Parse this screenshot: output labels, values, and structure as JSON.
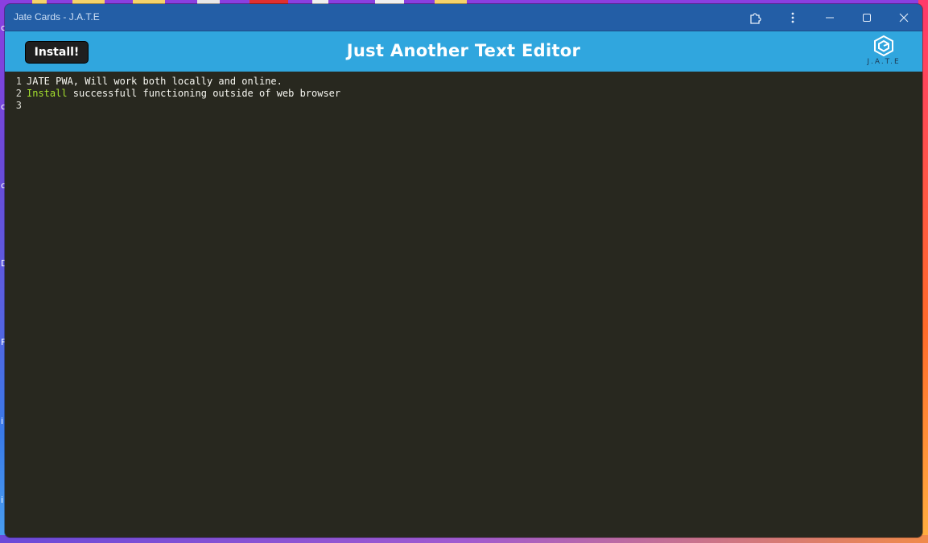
{
  "window": {
    "title": "Jate Cards - J.A.T.E",
    "controls": [
      "extension-icon",
      "more-icon",
      "minimize-icon",
      "maximize-icon",
      "close-icon"
    ]
  },
  "header": {
    "install_label": "Install!",
    "title": "Just Another Text Editor",
    "logo_text": "J.A.T.E",
    "background_color": "#30a6de"
  },
  "editor": {
    "background_color": "#28281f",
    "lines": [
      {
        "number": "1",
        "keyword": "",
        "text": "JATE PWA, Will work both locally and online."
      },
      {
        "number": "2",
        "keyword": "Install",
        "text": " successfull functioning outside of web browser"
      },
      {
        "number": "3",
        "keyword": "",
        "text": ""
      }
    ]
  },
  "desktop": {
    "edge_glyphs": [
      "c",
      "c",
      "c",
      "D",
      "F",
      "i",
      "i"
    ]
  }
}
